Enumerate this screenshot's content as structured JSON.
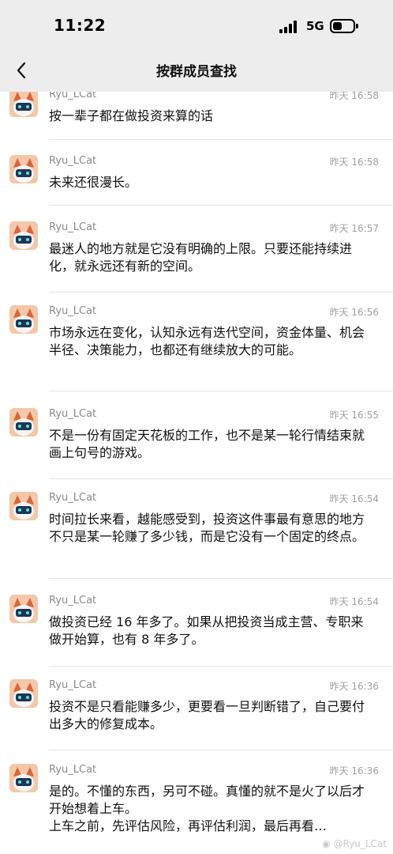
{
  "status_bar": {
    "time": "11:22",
    "network": "5G"
  },
  "nav": {
    "title": "按群成员查找"
  },
  "messages": [
    {
      "sender": "Ryu_LCat",
      "timestamp": "昨天 16:58",
      "text": "按一辈子都在做投资来算的话"
    },
    {
      "sender": "Ryu_LCat",
      "timestamp": "昨天 16:58",
      "text": "未来还很漫长。"
    },
    {
      "sender": "Ryu_LCat",
      "timestamp": "昨天 16:57",
      "text": "最迷人的地方就是它没有明确的上限。只要还能持续进化，就永远还有新的空间。"
    },
    {
      "sender": "Ryu_LCat",
      "timestamp": "昨天 16:56",
      "text": "市场永远在变化，认知永远有迭代空间，资金体量、机会半径、决策能力，也都还有继续放大的可能。"
    },
    {
      "sender": "Ryu_LCat",
      "timestamp": "昨天 16:55",
      "text": "不是一份有固定天花板的工作，也不是某一轮行情结束就画上句号的游戏。"
    },
    {
      "sender": "Ryu_LCat",
      "timestamp": "昨天 16:54",
      "text": "时间拉长来看，越能感受到，投资这件事最有意思的地方不只是某一轮赚了多少钱，而是它没有一个固定的终点。"
    },
    {
      "sender": "Ryu_LCat",
      "timestamp": "昨天 16:54",
      "text": "做投资已经 16 年多了。如果从把投资当成主营、专职来做开始算，也有 8 年多了。"
    },
    {
      "sender": "Ryu_LCat",
      "timestamp": "昨天 16:36",
      "text": "投资不是只看能赚多少，更要看一旦判断错了，自己要付出多大的修复成本。"
    },
    {
      "sender": "Ryu_LCat",
      "timestamp": "昨天 16:36",
      "text": "是的。不懂的东西，另可不碰。真懂的就不是火了以后才开始想着上车。\n上车之前，先评估风险，再评估利润，最后再看…"
    }
  ],
  "watermark": "@Ryu_LCat",
  "colors": {
    "bar_bg": "#ededed",
    "muted_text": "#8a8a8a",
    "separator": "#e6e6e6"
  }
}
